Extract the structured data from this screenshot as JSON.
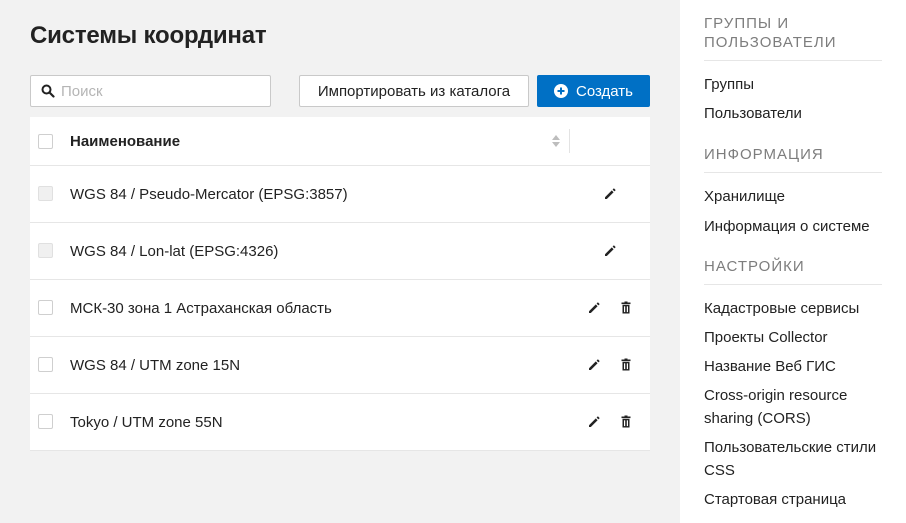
{
  "page": {
    "title": "Системы координат"
  },
  "toolbar": {
    "search_placeholder": "Поиск",
    "import_label": "Импортировать из каталога",
    "create_label": "Создать"
  },
  "table": {
    "header": {
      "name": "Наименование"
    },
    "rows": [
      {
        "name": "WGS 84 / Pseudo-Mercator (EPSG:3857)",
        "editable": true,
        "deletable": false,
        "selectable": false
      },
      {
        "name": "WGS 84 / Lon-lat (EPSG:4326)",
        "editable": true,
        "deletable": false,
        "selectable": false
      },
      {
        "name": "МСК-30 зона 1 Астраханская область",
        "editable": true,
        "deletable": true,
        "selectable": true
      },
      {
        "name": "WGS 84 / UTM zone 15N",
        "editable": true,
        "deletable": true,
        "selectable": true
      },
      {
        "name": "Tokyo / UTM zone 55N",
        "editable": true,
        "deletable": true,
        "selectable": true
      }
    ]
  },
  "sidebar": {
    "sections": [
      {
        "heading": "Группы и пользователи",
        "items": [
          "Группы",
          "Пользователи"
        ]
      },
      {
        "heading": "Информация",
        "items": [
          "Хранилище",
          "Информация о системе"
        ]
      },
      {
        "heading": "Настройки",
        "items": [
          "Кадастровые сервисы",
          "Проекты Collector",
          "Название Веб ГИС",
          "Cross-origin resource sharing (CORS)",
          "Пользовательские стили CSS",
          "Стартовая страница"
        ]
      }
    ]
  },
  "icons": {
    "search": "search-icon",
    "create": "plus-circle-icon",
    "sort": "sort-icon",
    "edit": "pencil-icon",
    "delete": "trash-icon"
  },
  "colors": {
    "accent": "#0070c5",
    "background": "#f2f2f2",
    "sidebar_heading": "#7d7d7d"
  }
}
